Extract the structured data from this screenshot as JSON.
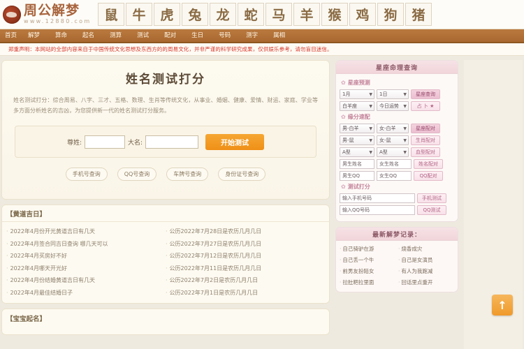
{
  "site": {
    "logo_title": "周公解梦",
    "logo_url": "www.12880.com"
  },
  "zodiac": [
    "鼠",
    "牛",
    "虎",
    "兔",
    "龙",
    "蛇",
    "马",
    "羊",
    "猴",
    "鸡",
    "狗",
    "猪"
  ],
  "nav": [
    {
      "label": "首页"
    },
    {
      "label": "解梦"
    },
    {
      "label": "算命"
    },
    {
      "label": "起名"
    },
    {
      "label": "测算"
    },
    {
      "label": "测试"
    },
    {
      "label": "配对"
    },
    {
      "label": "生日"
    },
    {
      "label": "号码"
    },
    {
      "label": "测字"
    },
    {
      "label": "属相"
    }
  ],
  "notice": {
    "text": "郑重声明：本网站的全部内容来自于中国传统文化思想及东西方的的周易文化，并非严谨的科学研究成果，仅供娱乐参考，请勿盲目迷信。"
  },
  "main": {
    "title": "姓名测试打分",
    "description": "姓名测试打分：综合周易、八字、三才、五格、数理、生肖等传统文化，从事业、婚姻、健康、爱情、财运、家庭、学业等多方面分析姓名的吉凶，为您提供新一代的姓名测试打分服务。",
    "form": {
      "surname_label": "尊姓:",
      "surname_value": "",
      "surname_placeholder": "",
      "givenname_label": "大名:",
      "givenname_value": "",
      "givenname_placeholder": "",
      "submit_label": "开始测试"
    },
    "quick_buttons": [
      {
        "label": "手机号查询"
      },
      {
        "label": "QQ号查询"
      },
      {
        "label": "车牌号查询"
      },
      {
        "label": "身份证号查询"
      }
    ]
  },
  "luckyday": {
    "heading": "【黄道吉日】",
    "left_items": [
      {
        "label": "2022年4月份开光黄道吉日有几天"
      },
      {
        "label": "2022年4月签合同吉日查询 哪几天可以"
      },
      {
        "label": "2022年4月买房好不好"
      },
      {
        "label": "2022年4月哪天开光好"
      },
      {
        "label": "2022年4月份结婚黄道吉日有几天"
      },
      {
        "label": "2022年4月最佳结婚日子"
      }
    ],
    "right_items": [
      {
        "label": "公历2022年7月28日是农历几月几日"
      },
      {
        "label": "公历2022年7月27日是农历几月几日"
      },
      {
        "label": "公历2022年7月12日是农历几月几日"
      },
      {
        "label": "公历2022年7月11日是农历几月几日"
      },
      {
        "label": "公历2022年7月2日是农历几月几日"
      },
      {
        "label": "公历2022年7月1日是农历几月几日"
      }
    ]
  },
  "babyname": {
    "heading": "【宝宝起名】"
  },
  "sidebar": {
    "astro_panel": {
      "title": "星座命理查询",
      "sections": [
        {
          "name": "星座预测",
          "rows": [
            {
              "controls": [
                {
                  "type": "select",
                  "value": "1月",
                  "width": "w50"
                },
                {
                  "type": "select",
                  "value": "1日",
                  "width": "w46"
                },
                {
                  "type": "button",
                  "label": "星座查询",
                  "strong": true
                }
              ]
            },
            {
              "controls": [
                {
                  "type": "select",
                  "value": "白羊座",
                  "width": "w50"
                },
                {
                  "type": "select",
                  "value": "今日运势",
                  "width": "w46"
                },
                {
                  "type": "button",
                  "label": "占 卜 ★",
                  "strong": false
                }
              ]
            }
          ]
        },
        {
          "name": "缘分速配",
          "rows": [
            {
              "controls": [
                {
                  "type": "select",
                  "value": "男-白羊",
                  "width": "w50"
                },
                {
                  "type": "select",
                  "value": "女-白羊",
                  "width": "w46"
                },
                {
                  "type": "button",
                  "label": "星座配对",
                  "strong": true
                }
              ]
            },
            {
              "controls": [
                {
                  "type": "select",
                  "value": "男-鼠",
                  "width": "w50"
                },
                {
                  "type": "select",
                  "value": "女-鼠",
                  "width": "w46"
                },
                {
                  "type": "button",
                  "label": "生肖配对",
                  "strong": false
                }
              ]
            },
            {
              "controls": [
                {
                  "type": "select",
                  "value": "A型",
                  "width": "w50"
                },
                {
                  "type": "select",
                  "value": "A型",
                  "width": "w46"
                },
                {
                  "type": "button",
                  "label": "血型配对",
                  "strong": false
                }
              ]
            },
            {
              "controls": [
                {
                  "type": "text",
                  "value": "男生姓名",
                  "width": "w50"
                },
                {
                  "type": "text",
                  "value": "女生姓名",
                  "width": "w50"
                },
                {
                  "type": "button",
                  "label": "姓名配对",
                  "strong": false
                }
              ]
            },
            {
              "controls": [
                {
                  "type": "text",
                  "value": "男生QQ",
                  "width": "w50"
                },
                {
                  "type": "text",
                  "value": "女生QQ",
                  "width": "w50"
                },
                {
                  "type": "button",
                  "label": "QQ配对",
                  "strong": false
                }
              ]
            }
          ]
        },
        {
          "name": "测试打分",
          "rows": [
            {
              "controls": [
                {
                  "type": "text",
                  "value": "输入手机号码",
                  "width": "w110"
                },
                {
                  "type": "button",
                  "label": "手机测试",
                  "strong": false
                }
              ]
            },
            {
              "controls": [
                {
                  "type": "text",
                  "value": "输入QQ号码",
                  "width": "w110"
                },
                {
                  "type": "button",
                  "label": "QQ测试",
                  "strong": false
                }
              ]
            }
          ]
        }
      ]
    },
    "record_panel": {
      "title": "最新解梦记录：",
      "left_items": [
        {
          "label": "自己骑驴在游"
        },
        {
          "label": "自己丢一个牛"
        },
        {
          "label": "前男友扮陌女"
        },
        {
          "label": "拉肚粑拉里面"
        }
      ],
      "right_items": [
        {
          "label": "烧香成灾"
        },
        {
          "label": "自己是女演员"
        },
        {
          "label": "有人为我跑减"
        },
        {
          "label": "回话里点重开"
        }
      ]
    }
  },
  "scroll_top": {
    "label": "↑"
  }
}
